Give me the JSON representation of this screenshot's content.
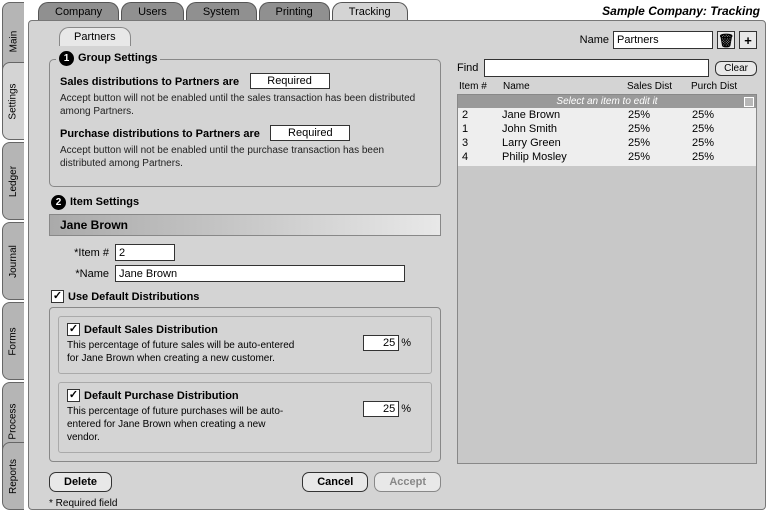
{
  "title": "Sample Company: Tracking",
  "side_tabs": [
    "Main",
    "Settings",
    "Ledger",
    "Journal",
    "Forms",
    "Process",
    "Reports"
  ],
  "active_side_tab": 1,
  "top_tabs": [
    "Company",
    "Users",
    "System",
    "Printing",
    "Tracking"
  ],
  "active_top_tab": 4,
  "sub_tabs": [
    "Partners"
  ],
  "name_label": "Name",
  "name_value": "Partners",
  "group_settings": {
    "legend": "Group Settings",
    "num": "1",
    "sales": {
      "label": "Sales distributions to Partners are",
      "value": "Required",
      "help": "Accept button will not be enabled until the sales transaction has been distributed among Partners."
    },
    "purchase": {
      "label": "Purchase distributions to Partners are",
      "value": "Required",
      "help": "Accept button will not be enabled until the purchase transaction has been distributed among Partners."
    }
  },
  "item_settings": {
    "legend": "Item Settings",
    "num": "2",
    "header": "Jane Brown",
    "item_num_label": "*Item #",
    "item_num_value": "2",
    "name_label": "*Name",
    "name_value": "Jane Brown",
    "use_default_label": "Use Default Distributions",
    "use_default_checked": true,
    "sales_dist": {
      "label": "Default Sales Distribution",
      "checked": true,
      "help": "This percentage of future sales will be auto-entered for Jane Brown when creating a new customer.",
      "value": "25"
    },
    "purchase_dist": {
      "label": "Default Purchase Distribution",
      "checked": true,
      "help": "This percentage of future purchases will be auto-entered for Jane Brown when creating a new vendor.",
      "value": "25"
    }
  },
  "buttons": {
    "delete": "Delete",
    "cancel": "Cancel",
    "accept": "Accept"
  },
  "required_note": "* Required field",
  "find": {
    "label": "Find",
    "value": "",
    "clear": "Clear"
  },
  "grid": {
    "headers": [
      "Item #",
      "Name",
      "Sales Dist",
      "Purch Dist"
    ],
    "banner": "Select an item to edit it",
    "rows": [
      {
        "num": "2",
        "name": "Jane Brown",
        "sales": "25%",
        "purch": "25%"
      },
      {
        "num": "1",
        "name": "John Smith",
        "sales": "25%",
        "purch": "25%"
      },
      {
        "num": "3",
        "name": "Larry Green",
        "sales": "25%",
        "purch": "25%"
      },
      {
        "num": "4",
        "name": "Philip Mosley",
        "sales": "25%",
        "purch": "25%"
      }
    ]
  },
  "checkmark": "✓",
  "pct": "%"
}
